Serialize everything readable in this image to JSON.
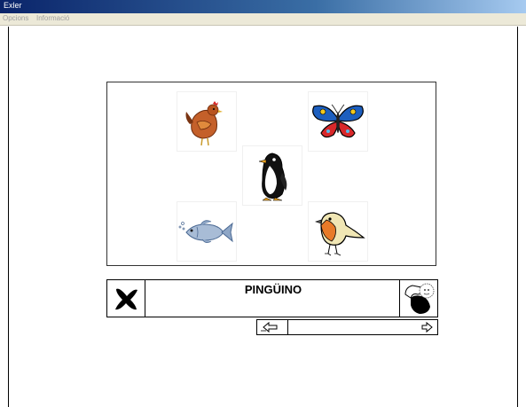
{
  "window": {
    "title": "Exler"
  },
  "menu": {
    "items": [
      "Opcions",
      "Informació"
    ]
  },
  "game": {
    "target_word": "PINGÜINO",
    "pictures": [
      {
        "name": "hen",
        "icon": "hen-icon"
      },
      {
        "name": "butterfly",
        "icon": "butterfly-icon"
      },
      {
        "name": "penguin",
        "icon": "penguin-icon"
      },
      {
        "name": "fish",
        "icon": "fish-icon"
      },
      {
        "name": "robin",
        "icon": "robin-icon"
      }
    ]
  },
  "controls": {
    "cancel_icon": "x-mark-icon",
    "help_icon": "hand-pointer-icon",
    "prev_icon": "arrow-left-icon",
    "next_icon": "arrow-right-icon"
  }
}
